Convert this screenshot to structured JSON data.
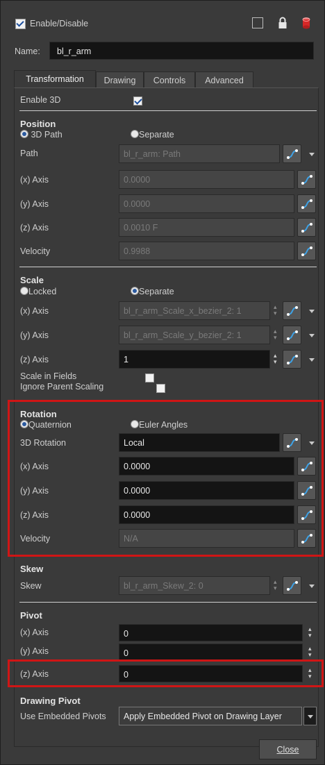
{
  "header": {
    "enable_label": "Enable/Disable",
    "enable_checked": true
  },
  "name": {
    "label": "Name:",
    "value": "bl_r_arm"
  },
  "tabs": [
    "Transformation",
    "Drawing",
    "Controls",
    "Advanced"
  ],
  "enable3d": {
    "label": "Enable 3D",
    "checked": true
  },
  "position": {
    "title": "Position",
    "radio_3dpath": "3D Path",
    "radio_separate": "Separate",
    "path_label": "Path",
    "path_value": "bl_r_arm: Path",
    "x_label": "(x) Axis",
    "x_value": "0.0000",
    "y_label": "(y) Axis",
    "y_value": "0.0000",
    "z_label": "(z) Axis",
    "z_value": "0.0010 F",
    "velocity_label": "Velocity",
    "velocity_value": "0.9988"
  },
  "scale": {
    "title": "Scale",
    "radio_locked": "Locked",
    "radio_separate": "Separate",
    "x_label": "(x) Axis",
    "x_value": "bl_r_arm_Scale_x_bezier_2: 1",
    "y_label": "(y) Axis",
    "y_value": "bl_r_arm_Scale_y_bezier_2: 1",
    "z_label": "(z) Axis",
    "z_value": "1",
    "fields_label": "Scale in Fields",
    "ignore_label": "Ignore Parent Scaling"
  },
  "rotation": {
    "title": "Rotation",
    "radio_quat": "Quaternion",
    "radio_euler": "Euler Angles",
    "rot3d_label": "3D Rotation",
    "rot3d_value": "Local",
    "x_label": "(x) Axis",
    "x_value": "0.0000",
    "y_label": "(y) Axis",
    "y_value": "0.0000",
    "z_label": "(z) Axis",
    "z_value": "0.0000",
    "velocity_label": "Velocity",
    "velocity_value": "N/A"
  },
  "skew": {
    "title": "Skew",
    "label": "Skew",
    "value": "bl_r_arm_Skew_2: 0"
  },
  "pivot": {
    "title": "Pivot",
    "x_label": "(x) Axis",
    "x_value": "0",
    "y_label": "(y) Axis",
    "y_value": "0",
    "z_label": "(z) Axis",
    "z_value": "0"
  },
  "drawing_pivot": {
    "title": "Drawing Pivot",
    "label": "Use Embedded Pivots",
    "value": "Apply Embedded Pivot on Drawing Layer"
  },
  "close_label": "Close",
  "colors": {
    "highlight": "#d01515",
    "field_bg": "#141414",
    "panel_bg": "#3a3a3a"
  }
}
